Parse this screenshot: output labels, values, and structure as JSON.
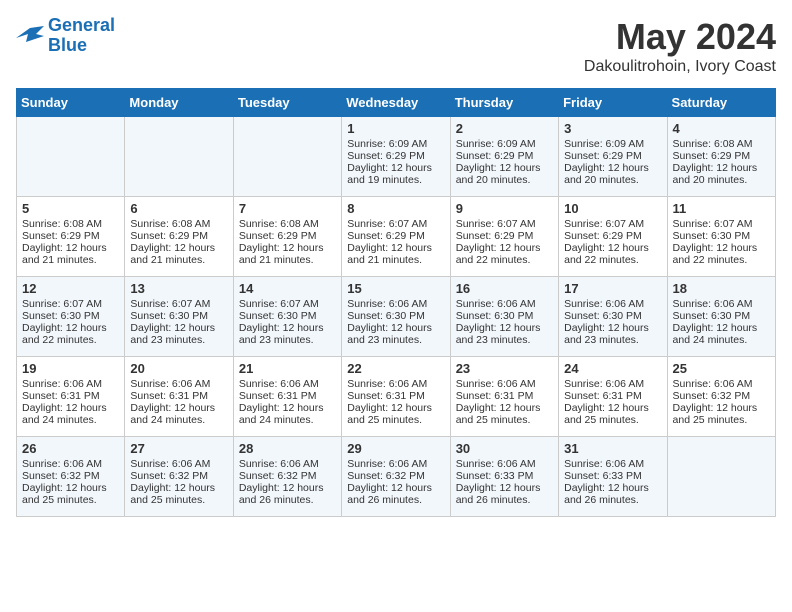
{
  "logo": {
    "line1": "General",
    "line2": "Blue"
  },
  "title": "May 2024",
  "location": "Dakoulitrohoin, Ivory Coast",
  "days_of_week": [
    "Sunday",
    "Monday",
    "Tuesday",
    "Wednesday",
    "Thursday",
    "Friday",
    "Saturday"
  ],
  "weeks": [
    [
      {
        "day": "",
        "sunrise": "",
        "sunset": "",
        "daylight": ""
      },
      {
        "day": "",
        "sunrise": "",
        "sunset": "",
        "daylight": ""
      },
      {
        "day": "",
        "sunrise": "",
        "sunset": "",
        "daylight": ""
      },
      {
        "day": "1",
        "sunrise": "Sunrise: 6:09 AM",
        "sunset": "Sunset: 6:29 PM",
        "daylight": "Daylight: 12 hours and 19 minutes."
      },
      {
        "day": "2",
        "sunrise": "Sunrise: 6:09 AM",
        "sunset": "Sunset: 6:29 PM",
        "daylight": "Daylight: 12 hours and 20 minutes."
      },
      {
        "day": "3",
        "sunrise": "Sunrise: 6:09 AM",
        "sunset": "Sunset: 6:29 PM",
        "daylight": "Daylight: 12 hours and 20 minutes."
      },
      {
        "day": "4",
        "sunrise": "Sunrise: 6:08 AM",
        "sunset": "Sunset: 6:29 PM",
        "daylight": "Daylight: 12 hours and 20 minutes."
      }
    ],
    [
      {
        "day": "5",
        "sunrise": "Sunrise: 6:08 AM",
        "sunset": "Sunset: 6:29 PM",
        "daylight": "Daylight: 12 hours and 21 minutes."
      },
      {
        "day": "6",
        "sunrise": "Sunrise: 6:08 AM",
        "sunset": "Sunset: 6:29 PM",
        "daylight": "Daylight: 12 hours and 21 minutes."
      },
      {
        "day": "7",
        "sunrise": "Sunrise: 6:08 AM",
        "sunset": "Sunset: 6:29 PM",
        "daylight": "Daylight: 12 hours and 21 minutes."
      },
      {
        "day": "8",
        "sunrise": "Sunrise: 6:07 AM",
        "sunset": "Sunset: 6:29 PM",
        "daylight": "Daylight: 12 hours and 21 minutes."
      },
      {
        "day": "9",
        "sunrise": "Sunrise: 6:07 AM",
        "sunset": "Sunset: 6:29 PM",
        "daylight": "Daylight: 12 hours and 22 minutes."
      },
      {
        "day": "10",
        "sunrise": "Sunrise: 6:07 AM",
        "sunset": "Sunset: 6:29 PM",
        "daylight": "Daylight: 12 hours and 22 minutes."
      },
      {
        "day": "11",
        "sunrise": "Sunrise: 6:07 AM",
        "sunset": "Sunset: 6:30 PM",
        "daylight": "Daylight: 12 hours and 22 minutes."
      }
    ],
    [
      {
        "day": "12",
        "sunrise": "Sunrise: 6:07 AM",
        "sunset": "Sunset: 6:30 PM",
        "daylight": "Daylight: 12 hours and 22 minutes."
      },
      {
        "day": "13",
        "sunrise": "Sunrise: 6:07 AM",
        "sunset": "Sunset: 6:30 PM",
        "daylight": "Daylight: 12 hours and 23 minutes."
      },
      {
        "day": "14",
        "sunrise": "Sunrise: 6:07 AM",
        "sunset": "Sunset: 6:30 PM",
        "daylight": "Daylight: 12 hours and 23 minutes."
      },
      {
        "day": "15",
        "sunrise": "Sunrise: 6:06 AM",
        "sunset": "Sunset: 6:30 PM",
        "daylight": "Daylight: 12 hours and 23 minutes."
      },
      {
        "day": "16",
        "sunrise": "Sunrise: 6:06 AM",
        "sunset": "Sunset: 6:30 PM",
        "daylight": "Daylight: 12 hours and 23 minutes."
      },
      {
        "day": "17",
        "sunrise": "Sunrise: 6:06 AM",
        "sunset": "Sunset: 6:30 PM",
        "daylight": "Daylight: 12 hours and 23 minutes."
      },
      {
        "day": "18",
        "sunrise": "Sunrise: 6:06 AM",
        "sunset": "Sunset: 6:30 PM",
        "daylight": "Daylight: 12 hours and 24 minutes."
      }
    ],
    [
      {
        "day": "19",
        "sunrise": "Sunrise: 6:06 AM",
        "sunset": "Sunset: 6:31 PM",
        "daylight": "Daylight: 12 hours and 24 minutes."
      },
      {
        "day": "20",
        "sunrise": "Sunrise: 6:06 AM",
        "sunset": "Sunset: 6:31 PM",
        "daylight": "Daylight: 12 hours and 24 minutes."
      },
      {
        "day": "21",
        "sunrise": "Sunrise: 6:06 AM",
        "sunset": "Sunset: 6:31 PM",
        "daylight": "Daylight: 12 hours and 24 minutes."
      },
      {
        "day": "22",
        "sunrise": "Sunrise: 6:06 AM",
        "sunset": "Sunset: 6:31 PM",
        "daylight": "Daylight: 12 hours and 25 minutes."
      },
      {
        "day": "23",
        "sunrise": "Sunrise: 6:06 AM",
        "sunset": "Sunset: 6:31 PM",
        "daylight": "Daylight: 12 hours and 25 minutes."
      },
      {
        "day": "24",
        "sunrise": "Sunrise: 6:06 AM",
        "sunset": "Sunset: 6:31 PM",
        "daylight": "Daylight: 12 hours and 25 minutes."
      },
      {
        "day": "25",
        "sunrise": "Sunrise: 6:06 AM",
        "sunset": "Sunset: 6:32 PM",
        "daylight": "Daylight: 12 hours and 25 minutes."
      }
    ],
    [
      {
        "day": "26",
        "sunrise": "Sunrise: 6:06 AM",
        "sunset": "Sunset: 6:32 PM",
        "daylight": "Daylight: 12 hours and 25 minutes."
      },
      {
        "day": "27",
        "sunrise": "Sunrise: 6:06 AM",
        "sunset": "Sunset: 6:32 PM",
        "daylight": "Daylight: 12 hours and 25 minutes."
      },
      {
        "day": "28",
        "sunrise": "Sunrise: 6:06 AM",
        "sunset": "Sunset: 6:32 PM",
        "daylight": "Daylight: 12 hours and 26 minutes."
      },
      {
        "day": "29",
        "sunrise": "Sunrise: 6:06 AM",
        "sunset": "Sunset: 6:32 PM",
        "daylight": "Daylight: 12 hours and 26 minutes."
      },
      {
        "day": "30",
        "sunrise": "Sunrise: 6:06 AM",
        "sunset": "Sunset: 6:33 PM",
        "daylight": "Daylight: 12 hours and 26 minutes."
      },
      {
        "day": "31",
        "sunrise": "Sunrise: 6:06 AM",
        "sunset": "Sunset: 6:33 PM",
        "daylight": "Daylight: 12 hours and 26 minutes."
      },
      {
        "day": "",
        "sunrise": "",
        "sunset": "",
        "daylight": ""
      }
    ]
  ]
}
